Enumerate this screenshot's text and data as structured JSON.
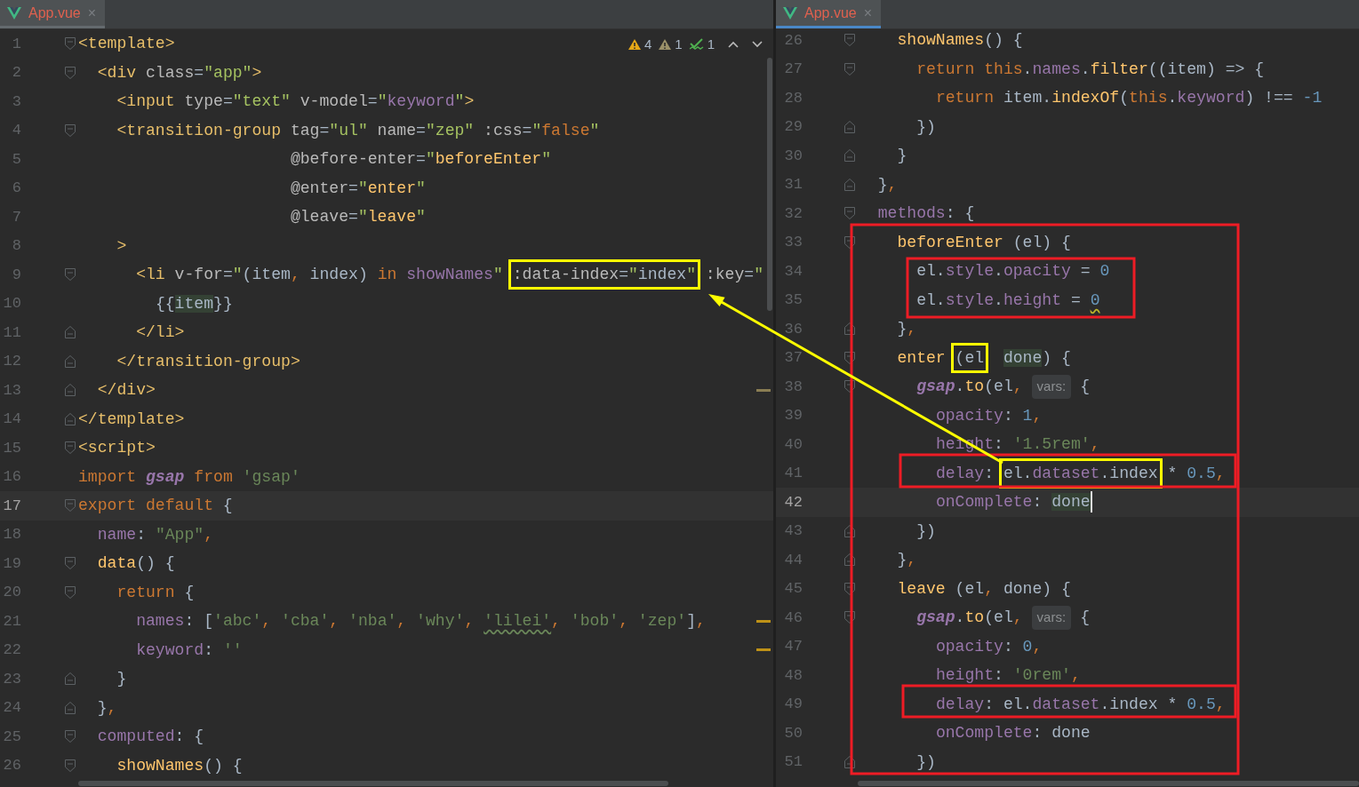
{
  "panes": [
    {
      "active": false,
      "tab": {
        "label": "App.vue",
        "close": "×",
        "selected": true
      },
      "inspections": [
        {
          "kind": "warning",
          "count": "4"
        },
        {
          "kind": "weak",
          "count": "1"
        },
        {
          "kind": "typo",
          "count": "1"
        }
      ],
      "lines": [
        {
          "number": "1",
          "fold": {
            "kind": "open"
          },
          "current": false,
          "cursor": false,
          "tokens": [
            {
              "text": "<template>",
              "kind": "tag"
            }
          ]
        },
        {
          "number": "2",
          "fold": {
            "kind": "open"
          },
          "current": false,
          "cursor": false,
          "tokens": [
            {
              "text": "  <div",
              "kind": "tag"
            },
            {
              "text": " class",
              "kind": "attr"
            },
            {
              "text": "=",
              "kind": "plain"
            },
            {
              "text": "\"app\"",
              "kind": "val"
            },
            {
              "text": ">",
              "kind": "tag"
            }
          ]
        },
        {
          "number": "3",
          "current": false,
          "cursor": false,
          "tokens": [
            {
              "text": "    <input",
              "kind": "tag"
            },
            {
              "text": " type",
              "kind": "attr"
            },
            {
              "text": "=",
              "kind": "plain"
            },
            {
              "text": "\"text\"",
              "kind": "val"
            },
            {
              "text": " v-model",
              "kind": "attr"
            },
            {
              "text": "=",
              "kind": "plain"
            },
            {
              "text": "\"",
              "kind": "val"
            },
            {
              "text": "keyword",
              "kind": "prop"
            },
            {
              "text": "\"",
              "kind": "val"
            },
            {
              "text": ">",
              "kind": "tag"
            }
          ]
        },
        {
          "number": "4",
          "fold": {
            "kind": "open"
          },
          "current": false,
          "cursor": false,
          "tokens": [
            {
              "text": "    <transition-group",
              "kind": "tag"
            },
            {
              "text": " tag",
              "kind": "attr"
            },
            {
              "text": "=",
              "kind": "plain"
            },
            {
              "text": "\"ul\"",
              "kind": "val"
            },
            {
              "text": " name",
              "kind": "attr"
            },
            {
              "text": "=",
              "kind": "plain"
            },
            {
              "text": "\"zep\"",
              "kind": "val"
            },
            {
              "text": " :css",
              "kind": "attr"
            },
            {
              "text": "=",
              "kind": "plain"
            },
            {
              "text": "\"",
              "kind": "val"
            },
            {
              "text": "false",
              "kind": "kw"
            },
            {
              "text": "\"",
              "kind": "val"
            }
          ]
        },
        {
          "number": "5",
          "current": false,
          "cursor": false,
          "tokens": [
            {
              "text": "                      @before-enter",
              "kind": "attr"
            },
            {
              "text": "=",
              "kind": "plain"
            },
            {
              "text": "\"",
              "kind": "val"
            },
            {
              "text": "beforeEnter",
              "kind": "fn"
            },
            {
              "text": "\"",
              "kind": "val"
            }
          ]
        },
        {
          "number": "6",
          "current": false,
          "cursor": false,
          "tokens": [
            {
              "text": "                      @enter",
              "kind": "attr"
            },
            {
              "text": "=",
              "kind": "plain"
            },
            {
              "text": "\"",
              "kind": "val"
            },
            {
              "text": "enter",
              "kind": "fn"
            },
            {
              "text": "\"",
              "kind": "val"
            }
          ]
        },
        {
          "number": "7",
          "current": false,
          "cursor": false,
          "tokens": [
            {
              "text": "                      @leave",
              "kind": "attr"
            },
            {
              "text": "=",
              "kind": "plain"
            },
            {
              "text": "\"",
              "kind": "val"
            },
            {
              "text": "leave",
              "kind": "fn"
            },
            {
              "text": "\"",
              "kind": "val"
            }
          ]
        },
        {
          "number": "8",
          "current": false,
          "cursor": false,
          "tokens": [
            {
              "text": "    >",
              "kind": "tag"
            }
          ]
        },
        {
          "number": "9",
          "fold": {
            "kind": "open"
          },
          "current": false,
          "cursor": false,
          "tokens": [
            {
              "text": "      <li",
              "kind": "tag"
            },
            {
              "text": " v-for",
              "kind": "attr"
            },
            {
              "text": "=",
              "kind": "plain"
            },
            {
              "text": "\"",
              "kind": "val"
            },
            {
              "text": "(item",
              "kind": "plain"
            },
            {
              "text": ",",
              "kind": "comma"
            },
            {
              "text": " index)",
              "kind": "plain"
            },
            {
              "text": " in",
              "kind": "kw"
            },
            {
              "text": " showNames",
              "kind": "prop"
            },
            {
              "text": "\"",
              "kind": "val"
            },
            {
              "kind": "frame",
              "tokens": [
                {
                  "text": " :data-index",
                  "kind": "attr"
                },
                {
                  "text": "=",
                  "kind": "plain"
                },
                {
                  "text": "\"",
                  "kind": "val"
                },
                {
                  "text": "index",
                  "kind": "plain"
                },
                {
                  "text": "\"",
                  "kind": "val"
                }
              ]
            },
            {
              "text": " :key",
              "kind": "attr"
            },
            {
              "text": "=",
              "kind": "plain"
            },
            {
              "text": "\"",
              "kind": "val"
            }
          ]
        },
        {
          "number": "10",
          "current": false,
          "cursor": false,
          "tokens": [
            {
              "text": "        {{",
              "kind": "plain"
            },
            {
              "text": "item",
              "kind": "ref"
            },
            {
              "text": "}}",
              "kind": "plain"
            }
          ]
        },
        {
          "number": "11",
          "fold": {
            "kind": "close"
          },
          "current": false,
          "cursor": false,
          "tokens": [
            {
              "text": "      </li>",
              "kind": "tag"
            }
          ]
        },
        {
          "number": "12",
          "fold": {
            "kind": "close"
          },
          "current": false,
          "cursor": false,
          "tokens": [
            {
              "text": "    </transition-group>",
              "kind": "tag"
            }
          ]
        },
        {
          "number": "13",
          "fold": {
            "kind": "close"
          },
          "current": false,
          "cursor": false,
          "marker": {
            "kind": "weak"
          },
          "tokens": [
            {
              "text": "  </div>",
              "kind": "tag"
            }
          ]
        },
        {
          "number": "14",
          "fold": {
            "kind": "close"
          },
          "current": false,
          "cursor": false,
          "tokens": [
            {
              "text": "</template>",
              "kind": "tag"
            }
          ]
        },
        {
          "number": "15",
          "fold": {
            "kind": "open"
          },
          "current": false,
          "cursor": false,
          "tokens": [
            {
              "text": "<script>",
              "kind": "tag"
            }
          ]
        },
        {
          "number": "16",
          "current": false,
          "cursor": false,
          "tokens": [
            {
              "text": "import ",
              "kind": "kw"
            },
            {
              "text": "gsap",
              "kind": "global"
            },
            {
              "text": " from",
              "kind": "kw"
            },
            {
              "text": " 'gsap'",
              "kind": "jsstr"
            }
          ]
        },
        {
          "number": "17",
          "fold": {
            "kind": "open"
          },
          "current": true,
          "cursor": false,
          "tokens": [
            {
              "text": "export default",
              "kind": "kw"
            },
            {
              "text": " {",
              "kind": "plain"
            }
          ]
        },
        {
          "number": "18",
          "current": false,
          "cursor": false,
          "tokens": [
            {
              "text": "  name",
              "kind": "prop"
            },
            {
              "text": ": ",
              "kind": "plain"
            },
            {
              "text": "\"App\"",
              "kind": "jsstr"
            },
            {
              "text": ",",
              "kind": "comma"
            }
          ]
        },
        {
          "number": "19",
          "fold": {
            "kind": "open"
          },
          "current": false,
          "cursor": false,
          "tokens": [
            {
              "text": "  data",
              "kind": "fn"
            },
            {
              "text": "() {",
              "kind": "plain"
            }
          ]
        },
        {
          "number": "20",
          "fold": {
            "kind": "open"
          },
          "current": false,
          "cursor": false,
          "tokens": [
            {
              "text": "    return",
              "kind": "kw"
            },
            {
              "text": " {",
              "kind": "plain"
            }
          ]
        },
        {
          "number": "21",
          "current": false,
          "cursor": false,
          "marker": {
            "kind": "warning"
          },
          "tokens": [
            {
              "text": "      names",
              "kind": "prop"
            },
            {
              "text": ": [",
              "kind": "plain"
            },
            {
              "text": "'abc'",
              "kind": "jsstr"
            },
            {
              "text": ",",
              "kind": "comma"
            },
            {
              "text": " 'cba'",
              "kind": "jsstr"
            },
            {
              "text": ",",
              "kind": "comma"
            },
            {
              "text": " 'nba'",
              "kind": "jsstr"
            },
            {
              "text": ",",
              "kind": "comma"
            },
            {
              "text": " 'why'",
              "kind": "jsstr"
            },
            {
              "text": ", ",
              "kind": "comma"
            },
            {
              "text": "'lilei'",
              "kind": "jsstr-typo"
            },
            {
              "text": ",",
              "kind": "comma"
            },
            {
              "text": " 'bob'",
              "kind": "jsstr"
            },
            {
              "text": ",",
              "kind": "comma"
            },
            {
              "text": " 'zep'",
              "kind": "jsstr"
            },
            {
              "text": "]",
              "kind": "plain"
            },
            {
              "text": ",",
              "kind": "comma"
            }
          ]
        },
        {
          "number": "22",
          "current": false,
          "cursor": false,
          "marker": {
            "kind": "warning"
          },
          "tokens": [
            {
              "text": "      keyword",
              "kind": "prop"
            },
            {
              "text": ": ",
              "kind": "plain"
            },
            {
              "text": "''",
              "kind": "jsstr"
            }
          ]
        },
        {
          "number": "23",
          "fold": {
            "kind": "close"
          },
          "current": false,
          "cursor": false,
          "tokens": [
            {
              "text": "    }",
              "kind": "plain"
            }
          ]
        },
        {
          "number": "24",
          "fold": {
            "kind": "close"
          },
          "current": false,
          "cursor": false,
          "tokens": [
            {
              "text": "  }",
              "kind": "plain"
            },
            {
              "text": ",",
              "kind": "comma"
            }
          ]
        },
        {
          "number": "25",
          "fold": {
            "kind": "open"
          },
          "current": false,
          "cursor": false,
          "tokens": [
            {
              "text": "  computed",
              "kind": "prop"
            },
            {
              "text": ": {",
              "kind": "plain"
            }
          ]
        },
        {
          "number": "26",
          "fold": {
            "kind": "open"
          },
          "current": false,
          "cursor": false,
          "tokens": [
            {
              "text": "    showNames",
              "kind": "fn"
            },
            {
              "text": "() {",
              "kind": "plain"
            }
          ]
        }
      ]
    },
    {
      "active": true,
      "tab": {
        "label": "App.vue",
        "close": "×",
        "selected": true
      },
      "lines": [
        {
          "number": "26",
          "fold": {
            "kind": "open"
          },
          "current": false,
          "cursor": false,
          "tokens": [
            {
              "text": "    showNames",
              "kind": "fn"
            },
            {
              "text": "() {",
              "kind": "plain"
            }
          ]
        },
        {
          "number": "27",
          "fold": {
            "kind": "open"
          },
          "current": false,
          "cursor": false,
          "tokens": [
            {
              "text": "      return",
              "kind": "kw"
            },
            {
              "text": " this",
              "kind": "kw"
            },
            {
              "text": ".",
              "kind": "plain"
            },
            {
              "text": "names",
              "kind": "prop"
            },
            {
              "text": ".",
              "kind": "plain"
            },
            {
              "text": "filter",
              "kind": "fn"
            },
            {
              "text": "((item) => {",
              "kind": "plain"
            }
          ]
        },
        {
          "number": "28",
          "current": false,
          "cursor": false,
          "tokens": [
            {
              "text": "        return",
              "kind": "kw"
            },
            {
              "text": " item.",
              "kind": "plain"
            },
            {
              "text": "indexOf",
              "kind": "fn"
            },
            {
              "text": "(",
              "kind": "plain"
            },
            {
              "text": "this",
              "kind": "kw"
            },
            {
              "text": ".",
              "kind": "plain"
            },
            {
              "text": "keyword",
              "kind": "prop"
            },
            {
              "text": ") !== ",
              "kind": "plain"
            },
            {
              "text": "-1",
              "kind": "num"
            }
          ]
        },
        {
          "number": "29",
          "fold": {
            "kind": "close"
          },
          "current": false,
          "cursor": false,
          "tokens": [
            {
              "text": "      })",
              "kind": "plain"
            }
          ]
        },
        {
          "number": "30",
          "fold": {
            "kind": "close"
          },
          "current": false,
          "cursor": false,
          "tokens": [
            {
              "text": "    }",
              "kind": "plain"
            }
          ]
        },
        {
          "number": "31",
          "fold": {
            "kind": "close"
          },
          "current": false,
          "cursor": false,
          "tokens": [
            {
              "text": "  }",
              "kind": "plain"
            },
            {
              "text": ",",
              "kind": "comma"
            }
          ]
        },
        {
          "number": "32",
          "fold": {
            "kind": "open"
          },
          "current": false,
          "cursor": false,
          "tokens": [
            {
              "text": "  methods",
              "kind": "prop"
            },
            {
              "text": ": {",
              "kind": "plain"
            }
          ]
        },
        {
          "number": "33",
          "fold": {
            "kind": "open"
          },
          "current": false,
          "cursor": false,
          "tokens": [
            {
              "text": "    beforeEnter",
              "kind": "fn"
            },
            {
              "text": " (el) {",
              "kind": "plain"
            }
          ]
        },
        {
          "number": "34",
          "current": false,
          "cursor": false,
          "tokens": [
            {
              "text": "      el.",
              "kind": "plain"
            },
            {
              "text": "style",
              "kind": "prop"
            },
            {
              "text": ".",
              "kind": "plain"
            },
            {
              "text": "opacity",
              "kind": "prop"
            },
            {
              "text": " = ",
              "kind": "plain"
            },
            {
              "text": "0",
              "kind": "num"
            }
          ]
        },
        {
          "number": "35",
          "current": false,
          "cursor": false,
          "tokens": [
            {
              "text": "      el.",
              "kind": "plain"
            },
            {
              "text": "style",
              "kind": "prop"
            },
            {
              "text": ".",
              "kind": "plain"
            },
            {
              "text": "height",
              "kind": "prop"
            },
            {
              "text": " = ",
              "kind": "plain"
            },
            {
              "text": "0",
              "kind": "num-typo"
            }
          ]
        },
        {
          "number": "36",
          "fold": {
            "kind": "close"
          },
          "current": false,
          "cursor": false,
          "tokens": [
            {
              "text": "    }",
              "kind": "plain"
            },
            {
              "text": ",",
              "kind": "comma"
            }
          ]
        },
        {
          "number": "37",
          "fold": {
            "kind": "open"
          },
          "current": false,
          "cursor": false,
          "tokens": [
            {
              "text": "    enter",
              "kind": "fn"
            },
            {
              "kind": "frame",
              "tokens": [
                {
                  "text": " (el",
                  "kind": "plain"
                }
              ]
            },
            {
              "text": "  done",
              "kind": "ref"
            },
            {
              "text": ") {",
              "kind": "plain"
            }
          ]
        },
        {
          "number": "38",
          "fold": {
            "kind": "open"
          },
          "current": false,
          "cursor": false,
          "tokens": [
            {
              "text": "      gsap",
              "kind": "global"
            },
            {
              "text": ".",
              "kind": "plain"
            },
            {
              "text": "to",
              "kind": "fn"
            },
            {
              "text": "(el",
              "kind": "plain"
            },
            {
              "text": ",",
              "kind": "comma"
            },
            {
              "text": "vars:",
              "kind": "hint"
            },
            {
              "text": "{",
              "kind": "plain"
            }
          ]
        },
        {
          "number": "39",
          "current": false,
          "cursor": false,
          "tokens": [
            {
              "text": "        opacity",
              "kind": "prop"
            },
            {
              "text": ": ",
              "kind": "plain"
            },
            {
              "text": "1",
              "kind": "num"
            },
            {
              "text": ",",
              "kind": "comma"
            }
          ]
        },
        {
          "number": "40",
          "current": false,
          "cursor": false,
          "tokens": [
            {
              "text": "        height",
              "kind": "prop"
            },
            {
              "text": ": ",
              "kind": "plain"
            },
            {
              "text": "'1.5rem'",
              "kind": "jsstr"
            },
            {
              "text": ",",
              "kind": "comma"
            }
          ]
        },
        {
          "number": "41",
          "current": false,
          "cursor": false,
          "tokens": [
            {
              "text": "        delay",
              "kind": "prop"
            },
            {
              "text": ":",
              "kind": "plain"
            },
            {
              "kind": "frame",
              "tokens": [
                {
                  "text": " el.",
                  "kind": "plain"
                },
                {
                  "text": "dataset",
                  "kind": "prop"
                },
                {
                  "text": ".index",
                  "kind": "plain"
                }
              ]
            },
            {
              "text": " * ",
              "kind": "plain"
            },
            {
              "text": "0.5",
              "kind": "num"
            },
            {
              "text": ",",
              "kind": "comma"
            }
          ]
        },
        {
          "number": "42",
          "current": true,
          "cursor": true,
          "tokens": [
            {
              "text": "        onComplete",
              "kind": "prop"
            },
            {
              "text": ": ",
              "kind": "plain"
            },
            {
              "text": "done",
              "kind": "ref"
            }
          ]
        },
        {
          "number": "43",
          "fold": {
            "kind": "close"
          },
          "current": false,
          "cursor": false,
          "tokens": [
            {
              "text": "      })",
              "kind": "plain"
            }
          ]
        },
        {
          "number": "44",
          "fold": {
            "kind": "close"
          },
          "current": false,
          "cursor": false,
          "tokens": [
            {
              "text": "    }",
              "kind": "plain"
            },
            {
              "text": ",",
              "kind": "comma"
            }
          ]
        },
        {
          "number": "45",
          "fold": {
            "kind": "open"
          },
          "current": false,
          "cursor": false,
          "tokens": [
            {
              "text": "    leave",
              "kind": "fn"
            },
            {
              "text": " (el",
              "kind": "plain"
            },
            {
              "text": ",",
              "kind": "comma"
            },
            {
              "text": " done) {",
              "kind": "plain"
            }
          ]
        },
        {
          "number": "46",
          "fold": {
            "kind": "open"
          },
          "current": false,
          "cursor": false,
          "tokens": [
            {
              "text": "      gsap",
              "kind": "global"
            },
            {
              "text": ".",
              "kind": "plain"
            },
            {
              "text": "to",
              "kind": "fn"
            },
            {
              "text": "(el",
              "kind": "plain"
            },
            {
              "text": ",",
              "kind": "comma"
            },
            {
              "text": "vars:",
              "kind": "hint"
            },
            {
              "text": "{",
              "kind": "plain"
            }
          ]
        },
        {
          "number": "47",
          "current": false,
          "cursor": false,
          "tokens": [
            {
              "text": "        opacity",
              "kind": "prop"
            },
            {
              "text": ": ",
              "kind": "plain"
            },
            {
              "text": "0",
              "kind": "num"
            },
            {
              "text": ",",
              "kind": "comma"
            }
          ]
        },
        {
          "number": "48",
          "current": false,
          "cursor": false,
          "tokens": [
            {
              "text": "        height",
              "kind": "prop"
            },
            {
              "text": ": ",
              "kind": "plain"
            },
            {
              "text": "'0rem'",
              "kind": "jsstr"
            },
            {
              "text": ",",
              "kind": "comma"
            }
          ]
        },
        {
          "number": "49",
          "current": false,
          "cursor": false,
          "tokens": [
            {
              "text": "        delay",
              "kind": "prop"
            },
            {
              "text": ": el.",
              "kind": "plain"
            },
            {
              "text": "dataset",
              "kind": "prop"
            },
            {
              "text": ".index * ",
              "kind": "plain"
            },
            {
              "text": "0.5",
              "kind": "num"
            },
            {
              "text": ",",
              "kind": "comma"
            }
          ]
        },
        {
          "number": "50",
          "current": false,
          "cursor": false,
          "tokens": [
            {
              "text": "        onComplete",
              "kind": "prop"
            },
            {
              "text": ": done",
              "kind": "plain"
            }
          ]
        },
        {
          "number": "51",
          "fold": {
            "kind": "close"
          },
          "current": false,
          "cursor": false,
          "tokens": [
            {
              "text": "      })",
              "kind": "plain"
            }
          ]
        }
      ]
    }
  ]
}
